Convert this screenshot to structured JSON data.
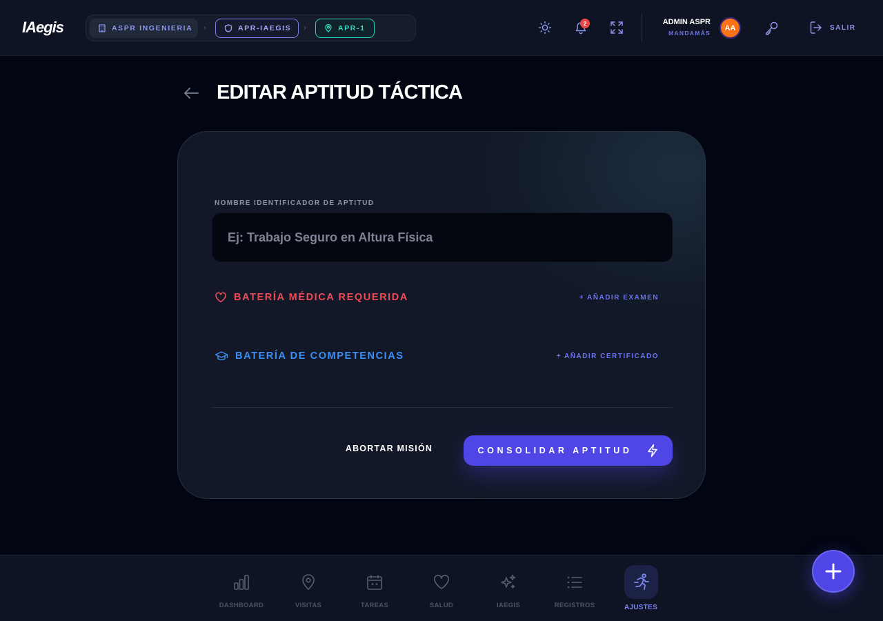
{
  "app": {
    "logo": "IAegis"
  },
  "breadcrumbs": [
    {
      "label": "ASPR INGENIERIA",
      "icon": "building-icon"
    },
    {
      "label": "APR-IAEGIS",
      "icon": "shield-icon"
    },
    {
      "label": "APR-1",
      "icon": "map-pin-icon"
    }
  ],
  "header": {
    "notification_count": "2",
    "user_name": "ADMIN ASPR",
    "user_role": "MANDAMÁS",
    "avatar_initials": "AA",
    "logout_label": "SALIR"
  },
  "page": {
    "title": "EDITAR APTITUD TÁCTICA"
  },
  "form": {
    "name_label": "NOMBRE IDENTIFICADOR DE APTITUD",
    "name_value": "",
    "name_placeholder": "Ej: Trabajo Seguro en Altura Física",
    "medical_title": "BATERÍA MÉDICA REQUERIDA",
    "medical_add": "+ AÑADIR EXAMEN",
    "competencies_title": "BATERÍA DE COMPETENCIAS",
    "competencies_add": "+ AÑADIR CERTIFICADO",
    "abort_label": "ABORTAR MISIÓN",
    "submit_label": "CONSOLIDAR APTITUD"
  },
  "bottom_nav": [
    {
      "label": "DASHBOARD",
      "icon": "bar-chart-icon",
      "active": false
    },
    {
      "label": "VISITAS",
      "icon": "map-pin-icon",
      "active": false
    },
    {
      "label": "TAREAS",
      "icon": "calendar-icon",
      "active": false
    },
    {
      "label": "SALUD",
      "icon": "heart-icon",
      "active": false
    },
    {
      "label": "IAEGIS",
      "icon": "sparkles-icon",
      "active": false
    },
    {
      "label": "REGISTROS",
      "icon": "list-icon",
      "active": false
    },
    {
      "label": "AJUSTES",
      "icon": "running-person-icon",
      "active": true
    }
  ],
  "colors": {
    "accent": "#4f46e5",
    "medical": "#ef4a56",
    "competencies": "#3d8ff5",
    "location": "#36dcc2",
    "avatar": "#f97316"
  }
}
